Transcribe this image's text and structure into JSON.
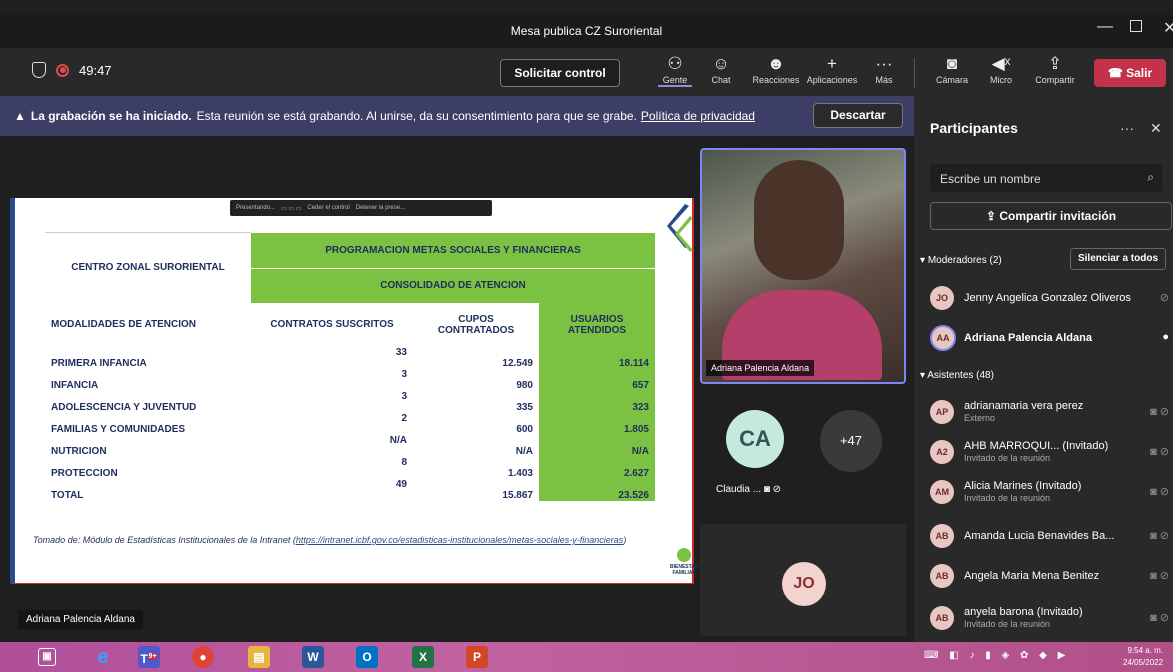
{
  "window": {
    "title": "Mesa publica CZ Suroriental"
  },
  "toolbar": {
    "timer": "49:47",
    "request_control": "Solicitar control",
    "gente": "Gente",
    "chat": "Chat",
    "reacciones": "Reacciones",
    "aplicaciones": "Aplicaciones",
    "mas": "Más",
    "camara": "Cámara",
    "micro": "Micro",
    "compartir": "Compartir",
    "salir": "Salir"
  },
  "banner": {
    "bold": "La grabación se ha iniciado.",
    "text": "Esta reunión se está grabando. Al unirse, da su consentimiento para que se grabe.",
    "link": "Política de privacidad",
    "dismiss": "Descartar"
  },
  "slide": {
    "toolbar_text_1": "Presentando...",
    "toolbar_text_2": "Ceder el control",
    "toolbar_text_3": "Detener la prese...",
    "header_left": "CENTRO ZONAL SURORIENTAL",
    "header_top": "PROGRAMACION METAS SOCIALES Y FINANCIERAS",
    "header_sub": "CONSOLIDADO DE ATENCION",
    "columns": [
      "MODALIDADES DE ATENCION",
      "CONTRATOS SUSCRITOS",
      "CUPOS CONTRATADOS",
      "USUARIOS ATENDIDOS"
    ],
    "rows": [
      [
        "PRIMERA INFANCIA",
        "33",
        "12.549",
        "18.114"
      ],
      [
        "INFANCIA",
        "3",
        "980",
        "657"
      ],
      [
        "ADOLESCENCIA Y JUVENTUD",
        "3",
        "335",
        "323"
      ],
      [
        "FAMILIAS Y COMUNIDADES",
        "2",
        "600",
        "1.805"
      ],
      [
        "NUTRICION",
        "N/A",
        "N/A",
        "N/A"
      ],
      [
        "PROTECCION",
        "8",
        "1.403",
        "2.627"
      ],
      [
        "TOTAL",
        "49",
        "15.867",
        "23.526"
      ]
    ],
    "source_prefix": "Tomado de: Módulo de Estadísticas Institucionales de la Intranet (",
    "source_link": "https://intranet.icbf.gov.co/estadisticas-institucionales/metas-sociales-y-financieras",
    "source_suffix": ")",
    "logo_text": "BIENESTAR FAMILIAR"
  },
  "presenter_label": "Adriana Palencia Aldana",
  "video": {
    "label": "Adriana Palencia Aldana"
  },
  "tiles": {
    "ca_initials": "CA",
    "ca_name": "Claudia ...",
    "more": "+47",
    "jo_initials": "JO"
  },
  "panel": {
    "title": "Participantes",
    "search_placeholder": "Escribe un nombre",
    "invite": "Compartir invitación",
    "moderators_header": "Moderadores (2)",
    "mute_all": "Silenciar a todos",
    "attendees_header": "Asistentes (48)",
    "moderators": [
      {
        "initials": "JO",
        "name": "Jenny Angelica Gonzalez Oliveros"
      },
      {
        "initials": "AA",
        "name": "Adriana Palencia Aldana"
      }
    ],
    "attendees": [
      {
        "initials": "AP",
        "name": "adrianamaria vera perez",
        "sub": "Externo"
      },
      {
        "initials": "A2",
        "name": "AHB MARROQUI... (Invitado)",
        "sub": "Invitado de la reunión"
      },
      {
        "initials": "AM",
        "name": "Alicia Marines (Invitado)",
        "sub": "Invitado de la reunión"
      },
      {
        "initials": "AB",
        "name": "Amanda Lucia Benavides Ba...",
        "sub": ""
      },
      {
        "initials": "AB",
        "name": "Angela Maria Mena Benitez",
        "sub": ""
      },
      {
        "initials": "AB",
        "name": "anyela barona (Invitado)",
        "sub": "Invitado de la reunión"
      }
    ]
  },
  "taskbar": {
    "teams_badge": "9+",
    "time": "9:54 a. m.",
    "date": "24/05/2022"
  },
  "colors": {
    "accent": "#7f85f5",
    "leave": "#c4314b",
    "banner": "#3d3e66",
    "table_green": "#7cc242"
  }
}
